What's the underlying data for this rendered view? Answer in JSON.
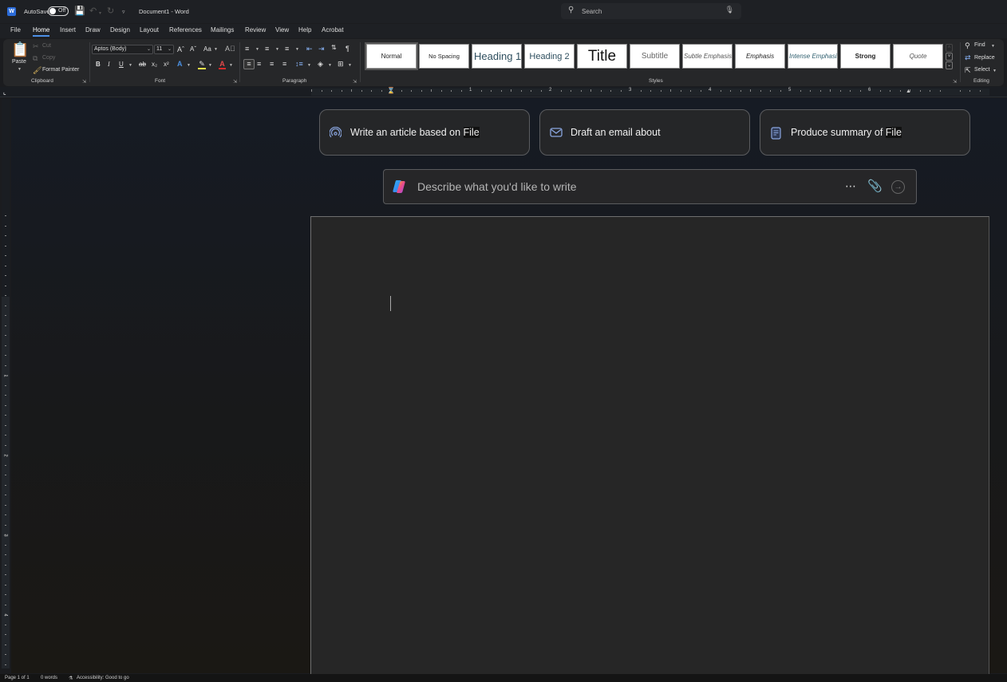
{
  "titlebar": {
    "app_icon": "word-logo-icon",
    "autosave_label": "AutoSave",
    "autosave_state": "Off",
    "document_title": "Document1  -  Word",
    "search_placeholder": "Search"
  },
  "tabs": [
    {
      "label": "File",
      "active": false
    },
    {
      "label": "Home",
      "active": true
    },
    {
      "label": "Insert",
      "active": false
    },
    {
      "label": "Draw",
      "active": false
    },
    {
      "label": "Design",
      "active": false
    },
    {
      "label": "Layout",
      "active": false
    },
    {
      "label": "References",
      "active": false
    },
    {
      "label": "Mailings",
      "active": false
    },
    {
      "label": "Review",
      "active": false
    },
    {
      "label": "View",
      "active": false
    },
    {
      "label": "Help",
      "active": false
    },
    {
      "label": "Acrobat",
      "active": false
    }
  ],
  "ribbon": {
    "clipboard": {
      "label": "Clipboard",
      "paste": "Paste",
      "cut": "Cut",
      "copy": "Copy",
      "format_painter": "Format Painter"
    },
    "font": {
      "label": "Font",
      "font_name": "Aptos (Body)",
      "font_size": "11",
      "change_case": "Aa"
    },
    "paragraph": {
      "label": "Paragraph"
    },
    "styles": {
      "label": "Styles",
      "items": [
        {
          "label": "Normal",
          "selected": true
        },
        {
          "label": "No Spacing",
          "selected": false
        },
        {
          "label": "Heading 1",
          "selected": false
        },
        {
          "label": "Heading 2",
          "selected": false
        },
        {
          "label": "Title",
          "selected": false
        },
        {
          "label": "Subtitle",
          "selected": false
        },
        {
          "label": "Subtle Emphasis",
          "selected": false
        },
        {
          "label": "Emphasis",
          "selected": false
        },
        {
          "label": "Intense Emphasis",
          "selected": false
        },
        {
          "label": "Strong",
          "selected": false
        },
        {
          "label": "Quote",
          "selected": false
        }
      ]
    },
    "editing": {
      "label": "Editing",
      "find": "Find",
      "replace": "Replace",
      "select": "Select"
    }
  },
  "ruler": {
    "h_numbers": [
      "1",
      "1",
      "2",
      "3",
      "4",
      "5",
      "6"
    ],
    "v_numbers": [
      "1",
      "2",
      "3",
      "4"
    ]
  },
  "copilot": {
    "suggestions": [
      {
        "icon": "article-icon",
        "text": "Write an article based on ",
        "highlight": "File"
      },
      {
        "icon": "mail-icon",
        "text": "Draft an email about",
        "highlight": ""
      },
      {
        "icon": "document-icon",
        "text": "Produce summary of ",
        "highlight": "File"
      }
    ],
    "prompt_placeholder": "Describe what you'd like to write"
  },
  "statusbar": {
    "page": "Page 1 of 1",
    "words": "0 words",
    "accessibility": "Accessibility: Good to go"
  }
}
